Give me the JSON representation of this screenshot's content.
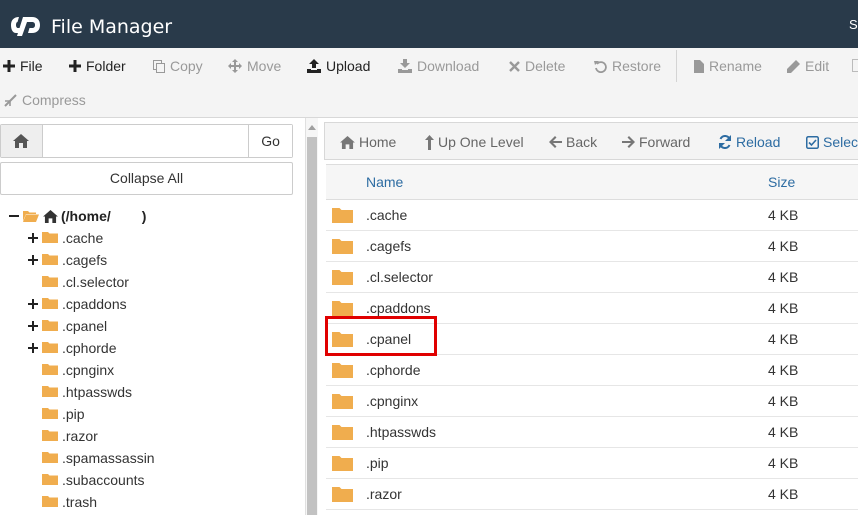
{
  "header": {
    "title": "File Manager",
    "right_text": "Se",
    "logo_icon": "cpanel-logo-icon",
    "bg_color": "#293a4a"
  },
  "toolbar": {
    "row1": [
      {
        "id": "file",
        "label": "File",
        "icon": "plus-icon",
        "enabled": true
      },
      {
        "id": "folder",
        "label": "Folder",
        "icon": "plus-icon",
        "enabled": true
      },
      {
        "id": "copy",
        "label": "Copy",
        "icon": "copy-icon",
        "enabled": false
      },
      {
        "id": "move",
        "label": "Move",
        "icon": "move-icon",
        "enabled": false
      },
      {
        "id": "upload",
        "label": "Upload",
        "icon": "upload-icon",
        "enabled": true
      },
      {
        "id": "download",
        "label": "Download",
        "icon": "download-icon",
        "enabled": false
      },
      {
        "id": "delete",
        "label": "Delete",
        "icon": "times-icon",
        "enabled": false
      },
      {
        "id": "restore",
        "label": "Restore",
        "icon": "undo-icon",
        "enabled": false
      },
      {
        "id": "rename",
        "label": "Rename",
        "icon": "file-icon",
        "enabled": false
      },
      {
        "id": "edit",
        "label": "Edit",
        "icon": "pencil-icon",
        "enabled": false
      }
    ],
    "row2": [
      {
        "id": "compress",
        "label": "Compress",
        "icon": "compress-icon",
        "enabled": false
      }
    ]
  },
  "left": {
    "path_value": "",
    "go_label": "Go",
    "collapse_label": "Collapse All",
    "root_label": "(/home/",
    "root_suffix": ")",
    "tree": [
      {
        "label": ".cache",
        "expandable": true
      },
      {
        "label": ".cagefs",
        "expandable": true
      },
      {
        "label": ".cl.selector",
        "expandable": false
      },
      {
        "label": ".cpaddons",
        "expandable": true
      },
      {
        "label": ".cpanel",
        "expandable": true
      },
      {
        "label": ".cphorde",
        "expandable": true
      },
      {
        "label": ".cpnginx",
        "expandable": false
      },
      {
        "label": ".htpasswds",
        "expandable": false
      },
      {
        "label": ".pip",
        "expandable": false
      },
      {
        "label": ".razor",
        "expandable": false
      },
      {
        "label": ".spamassassin",
        "expandable": false
      },
      {
        "label": ".subaccounts",
        "expandable": false
      },
      {
        "label": ".trash",
        "expandable": false
      }
    ]
  },
  "nav": {
    "home": "Home",
    "up": "Up One Level",
    "back": "Back",
    "forward": "Forward",
    "reload": "Reload",
    "select": "Select"
  },
  "table": {
    "col_name": "Name",
    "col_size": "Size",
    "rows": [
      {
        "name": ".cache",
        "size": "4 KB"
      },
      {
        "name": ".cagefs",
        "size": "4 KB"
      },
      {
        "name": ".cl.selector",
        "size": "4 KB"
      },
      {
        "name": ".cpaddons",
        "size": "4 KB"
      },
      {
        "name": ".cpanel",
        "size": "4 KB"
      },
      {
        "name": ".cphorde",
        "size": "4 KB"
      },
      {
        "name": ".cpnginx",
        "size": "4 KB"
      },
      {
        "name": ".htpasswds",
        "size": "4 KB"
      },
      {
        "name": ".pip",
        "size": "4 KB"
      },
      {
        "name": ".razor",
        "size": "4 KB"
      }
    ],
    "highlighted_row": ".cpanel"
  },
  "colors": {
    "folder": "#f0ad4e",
    "link_blue": "#2d6ca2",
    "highlight_red": "#e00000"
  }
}
